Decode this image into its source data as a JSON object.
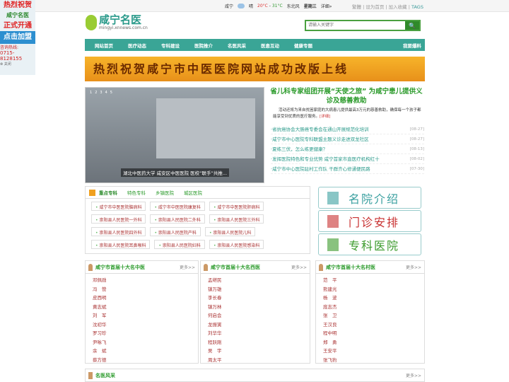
{
  "topbar": {
    "city": "咸宁",
    "weather": "晴",
    "temp_low": "20°C",
    "temp_high": "31°C",
    "wind": "东北风",
    "weekday": "星期三",
    "detail": "详细»",
    "links": [
      "繁體",
      "设为首页",
      "加入收藏"
    ],
    "tags": "TAGS"
  },
  "ad": {
    "line1": "热烈祝贺",
    "brand": "咸宁名医",
    "line2": "正式开通",
    "line3": "点击加盟",
    "hotline_label": "咨询热线:",
    "hotline": "0715-8128155",
    "close": "关闭"
  },
  "logo": {
    "title": "咸宁名医",
    "url": "mingyi.xnnews.com.cn"
  },
  "search": {
    "placeholder": "请输入关键字"
  },
  "nav": [
    "网站首页",
    "医疗动态",
    "专科建设",
    "医院推介",
    "名医风采",
    "医患互动",
    "健康专题"
  ],
  "nav_right": "我要爆料",
  "banner": "热烈祝贺咸宁市中医医院网站成功改版上线",
  "slider": {
    "dots": [
      "1",
      "2",
      "3",
      "4",
      "5"
    ],
    "caption": "湖北中医药大学 咸安区中医医院 医校“联手”共推..."
  },
  "headline": {
    "title": "省儿科专家组团开展“天使之旅” 为咸宁患儿提供义诊及慈善救助",
    "summary": "活动还将为来自贫困家庭的大病患儿提供最高3万元的慈善救助，确保每一个孩子都能享受到优质的医疗服务。",
    "more": "[详细]"
  },
  "news": [
    {
      "t": "·省抗癌协会大肠癌专委会在通山开展规范化培训",
      "d": "[08-27]"
    },
    {
      "t": "·咸宁市中心医院专科联盟主题义诊走进双龙社区",
      "d": "[08-27]"
    },
    {
      "t": "·夏练三伏，怎么练更健康？",
      "d": "[08-13]"
    },
    {
      "t": "·发挥医院特色和专业优势 咸宁首家市直医疗机构红十",
      "d": "[08-02]"
    },
    {
      "t": "·咸宁市中心医院驻村工作队 干群齐心修通便民路",
      "d": "[07-30]"
    }
  ],
  "tabs": {
    "items": [
      "重点专科",
      "特色专科",
      "乡镇医院",
      "城区医院"
    ],
    "chips": [
      "咸宁市中医医院脑病科",
      "咸宁市中医医院康复科",
      "咸宁市中医医院肝病科",
      "崇阳县人民医院一外科",
      "崇阳县人民医院二外科",
      "崇阳县人民医院三外科",
      "崇阳县人民医院四外科",
      "崇阳县人民医院产科",
      "崇阳县人民医院儿科",
      "崇阳县人民医院耳鼻喉科",
      "崇阳县人民医院妇科",
      "崇阳县人民医院感染科"
    ]
  },
  "quick": [
    {
      "label": "名院介绍",
      "color": "#3aa0a0"
    },
    {
      "label": "门诊安排",
      "color": "#c83030"
    },
    {
      "label": "专科医院",
      "color": "#3a9a2a"
    }
  ],
  "boxes": [
    {
      "title": "咸宁市首届十大名中医",
      "more": "更多>>",
      "names": [
        "邓佩勋",
        "冯　赞",
        "皮西明",
        "黄志斌",
        "刘　军",
        "沈初华",
        "罗习珍",
        "尹咏飞",
        "余　斌",
        "蔡方德"
      ]
    },
    {
      "title": "咸宁市首届十大名西医",
      "more": "更多>>",
      "names": [
        "孟继民",
        "镇万雄",
        "李长春",
        "镇万林",
        "何启会",
        "龙振寅",
        "刘华华",
        "程跃刚",
        "吴　宇",
        "周太平"
      ]
    },
    {
      "title": "咸宁市首届十大名村医",
      "more": "更多>>",
      "names": [
        "范　平",
        "熊建光",
        "杨　波",
        "庞志杰",
        "张　卫",
        "王汉良",
        "程中明",
        "郑　勇",
        "王安平",
        "张飞豹"
      ]
    }
  ],
  "bottom": {
    "title": "名医风采",
    "more": "更多>>"
  }
}
